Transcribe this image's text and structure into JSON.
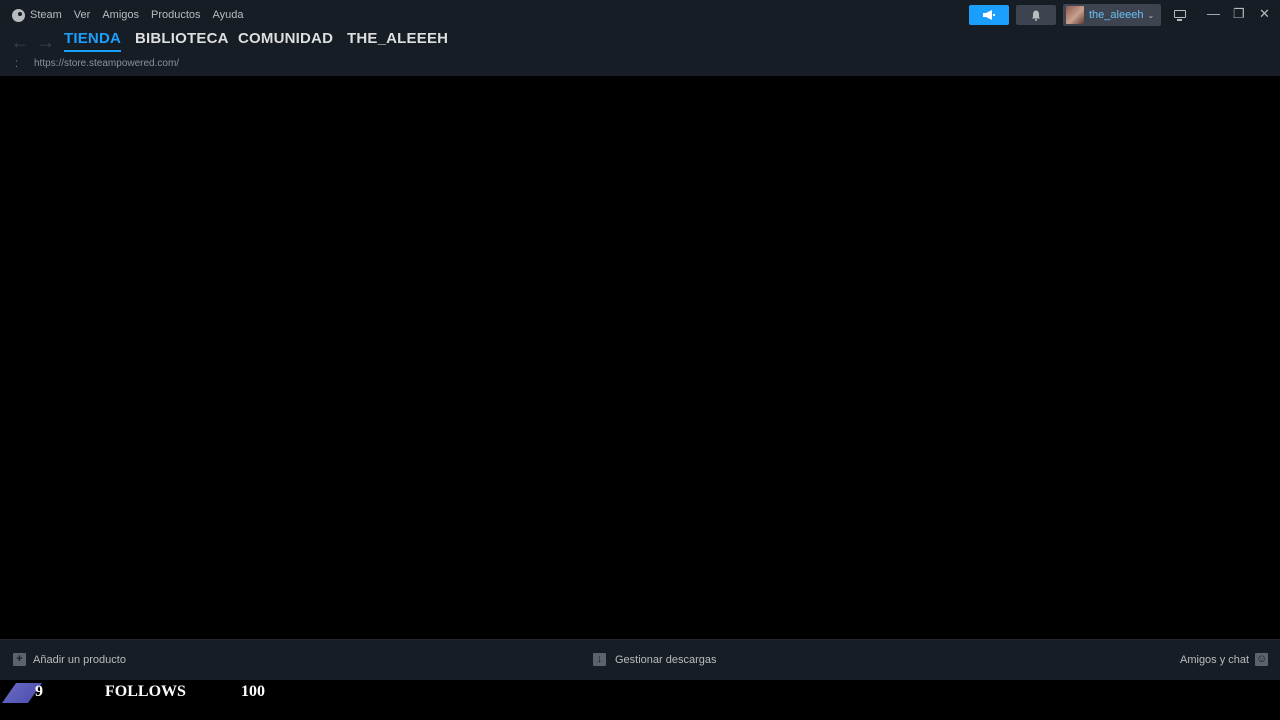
{
  "menu": {
    "items": [
      "Steam",
      "Ver",
      "Amigos",
      "Productos",
      "Ayuda"
    ]
  },
  "titlebar": {
    "username": "the_aleeeh",
    "announce_icon": "megaphone-icon",
    "notifications_icon": "bell-icon",
    "minimize_glyph": "—",
    "maximize_glyph": "❐",
    "close_glyph": "✕"
  },
  "nav": {
    "back_glyph": "←",
    "forward_glyph": "→",
    "tabs": [
      "TIENDA",
      "BIBLIOTECA",
      "COMUNIDAD",
      "THE_ALEEEH"
    ],
    "active_tab": "TIENDA",
    "url": "https://store.steampowered.com/"
  },
  "bottombar": {
    "add_product": "Añadir un producto",
    "manage_downloads": "Gestionar descargas",
    "friends_chat": "Amigos y chat"
  },
  "overlay": {
    "left_number": "9",
    "label": "FOLLOWS",
    "right_number": "100"
  },
  "colors": {
    "accent": "#1a9fff",
    "chrome_bg": "#171d25",
    "main_bg": "#000000",
    "username": "#66c0f4"
  }
}
